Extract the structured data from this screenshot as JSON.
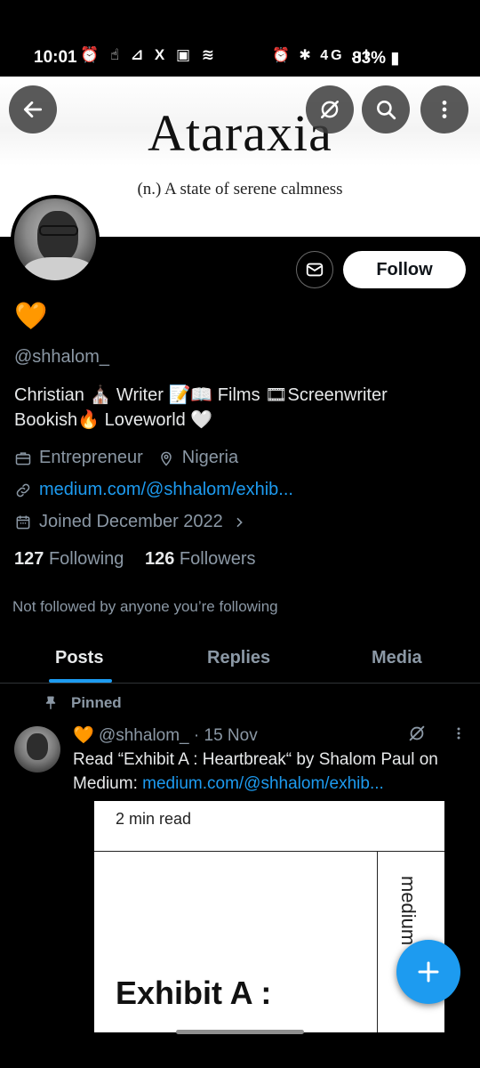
{
  "status_bar": {
    "time": "10:01",
    "left_icons": "⏰ ☝ ⊿ X ▣ ≋",
    "right_icons": "⏰ ✱ 4G .ıl",
    "battery": "83%"
  },
  "banner": {
    "title": "Ataraxia",
    "subtitle": "(n.) A state of serene calmness"
  },
  "profile": {
    "name_emoji": "🧡",
    "handle": "@shhalom_",
    "bio_line1": "Christian ⛪ Writer 📝📖 Films 🎞Screenwriter",
    "bio_line2": "Bookish🔥 Loveworld 🤍",
    "profession": "Entrepreneur",
    "location": "Nigeria",
    "link": "medium.com/@shhalom/exhib...",
    "joined": "Joined December 2022",
    "following_count": "127",
    "following_label": "Following",
    "followers_count": "126",
    "followers_label": "Followers",
    "not_followed": "Not followed by anyone you’re following",
    "follow_label": "Follow"
  },
  "tabs": [
    "Posts",
    "Replies",
    "Media"
  ],
  "active_tab": "Posts",
  "post": {
    "pinned_label": "Pinned",
    "heart": "🧡",
    "author_handle": "@shhalom_",
    "date": "· 15 Nov",
    "text": "Read “Exhibit A : Heartbreak“ by Shalom Paul on Medium:",
    "link": "medium.com/@shhalom/exhib...",
    "card_read_time": "2 min read",
    "card_side_text": "medium",
    "card_title": "Exhibit A :"
  },
  "colors": {
    "accent": "#1d9bf0",
    "muted": "#8b98a5",
    "background": "#000000"
  }
}
